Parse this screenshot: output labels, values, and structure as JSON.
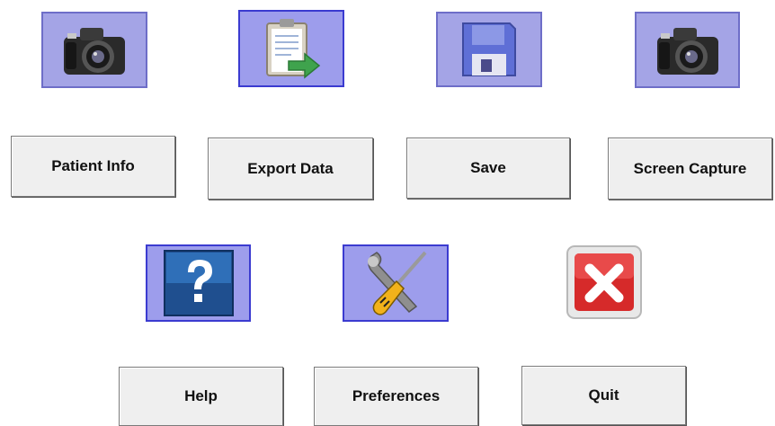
{
  "row1": {
    "patient_info_icon": "camera-icon",
    "export_data_icon": "clipboard-export-icon",
    "save_icon": "floppy-disk-icon",
    "screen_capture_icon": "camera-icon"
  },
  "buttons": {
    "patient_info": "Patient Info",
    "export_data": "Export Data",
    "save": "Save",
    "screen_capture": "Screen Capture",
    "help": "Help",
    "preferences": "Preferences",
    "quit": "Quit"
  },
  "row2": {
    "help_icon": "question-mark-icon",
    "preferences_icon": "wrench-screwdriver-icon",
    "quit_icon": "close-x-icon"
  },
  "colors": {
    "tile_fill": "#9d9dec",
    "tile_border": "#3b3bd0",
    "button_face": "#efefef",
    "quit_red": "#d62a2a"
  }
}
